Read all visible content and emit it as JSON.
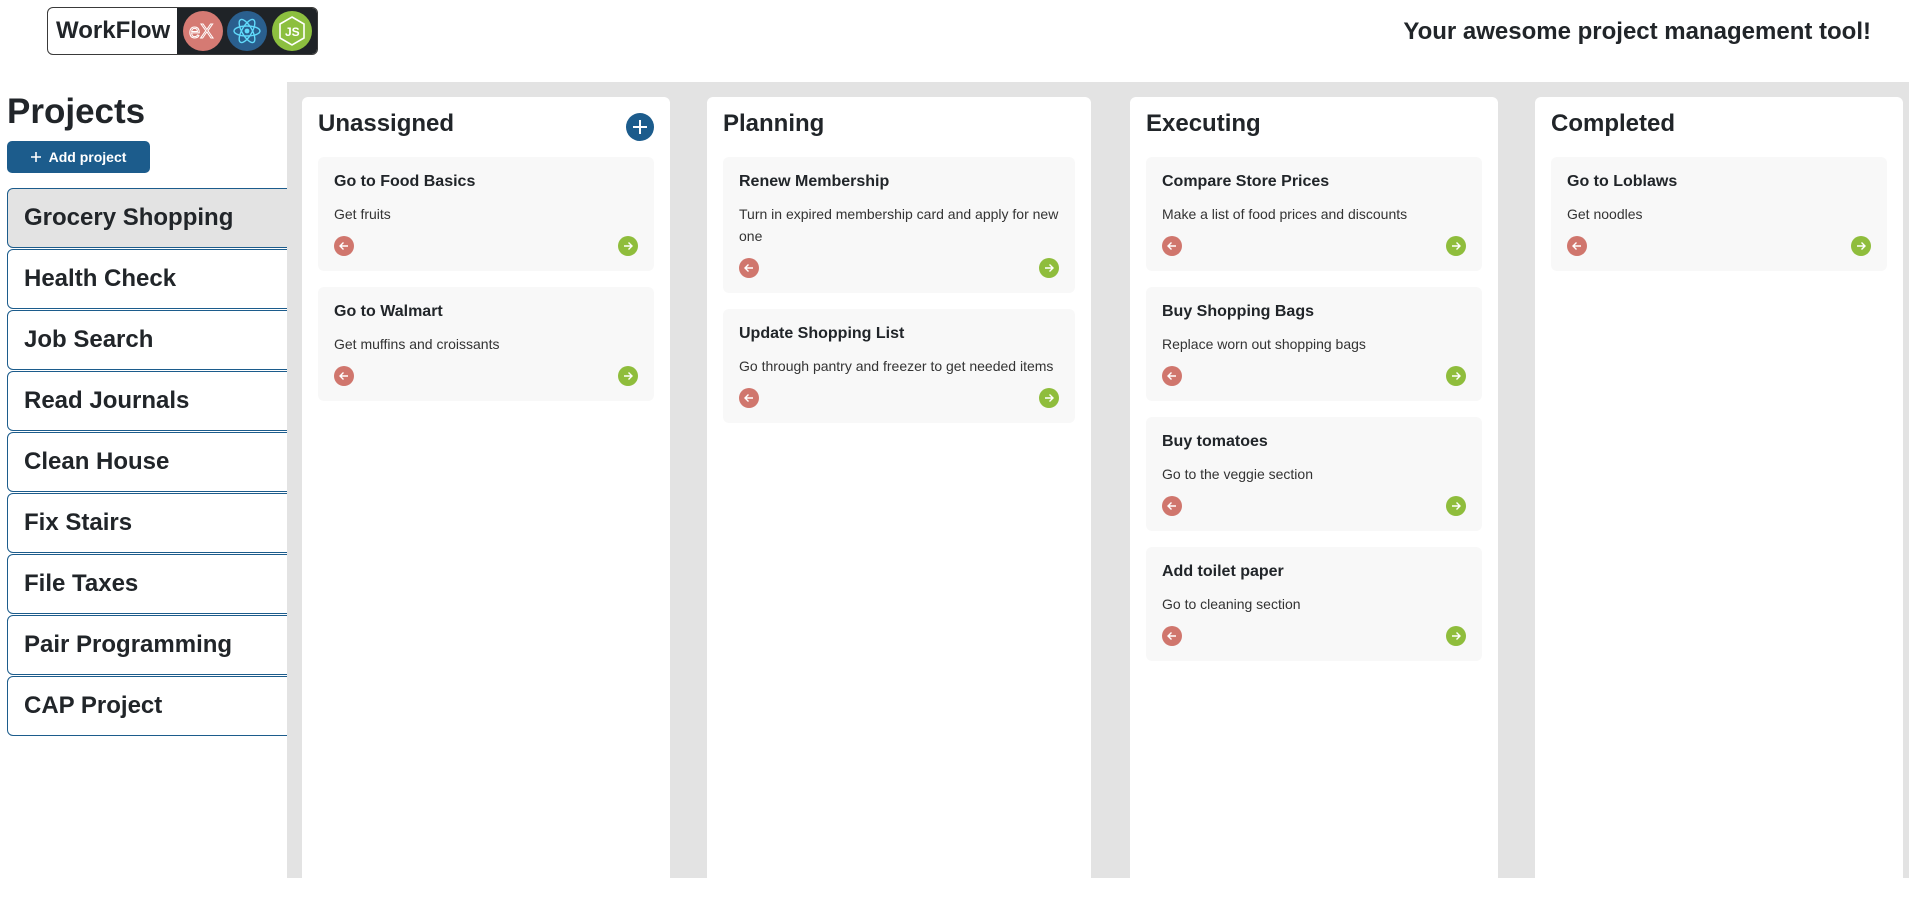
{
  "header": {
    "brand": "WorkFlow",
    "logos": [
      "express-logo-icon",
      "react-logo-icon",
      "nodejs-logo-icon"
    ],
    "tagline": "Your awesome project management tool!"
  },
  "sidebar": {
    "title": "Projects",
    "add_label": "Add project",
    "projects": [
      {
        "label": "Grocery Shopping",
        "active": true
      },
      {
        "label": "Health Check"
      },
      {
        "label": "Job Search"
      },
      {
        "label": "Read Journals"
      },
      {
        "label": "Clean House"
      },
      {
        "label": "Fix Stairs"
      },
      {
        "label": "File Taxes"
      },
      {
        "label": "Pair Programming"
      },
      {
        "label": "CAP Project"
      }
    ]
  },
  "board": {
    "columns": [
      {
        "title": "Unassigned",
        "cards": [
          {
            "title": "Go to Food Basics",
            "desc": "Get fruits"
          },
          {
            "title": "Go to Walmart",
            "desc": "Get muffins and croissants"
          }
        ]
      },
      {
        "title": "Planning",
        "cards": [
          {
            "title": "Renew Membership",
            "desc": "Turn in expired membership card and apply for new one"
          },
          {
            "title": "Update Shopping List",
            "desc": "Go through pantry and freezer to get needed items"
          }
        ]
      },
      {
        "title": "Executing",
        "cards": [
          {
            "title": "Compare Store Prices",
            "desc": "Make a list of food prices and discounts"
          },
          {
            "title": "Buy Shopping Bags",
            "desc": "Replace worn out shopping bags"
          },
          {
            "title": "Buy tomatoes",
            "desc": "Go to the veggie section"
          },
          {
            "title": "Add toilet paper",
            "desc": "Go to cleaning section"
          }
        ]
      },
      {
        "title": "Completed",
        "cards": [
          {
            "title": "Go to Loblaws",
            "desc": "Get noodles"
          }
        ]
      }
    ]
  },
  "colors": {
    "accent": "#1c5c8c",
    "back_arrow": "#d0766d",
    "forward_arrow": "#8fbd3c",
    "board_bg": "#e3e3e3"
  }
}
